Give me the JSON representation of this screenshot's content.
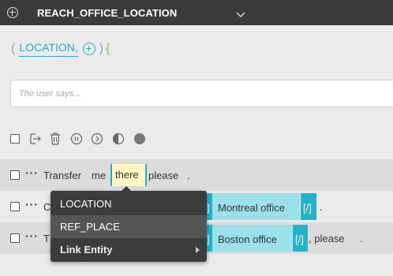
{
  "header": {
    "title": "REACH_OFFICE_LOCATION"
  },
  "params": {
    "open_paren": "(",
    "name": "LOCATION,",
    "close_paren": ")",
    "brace": "{"
  },
  "says": {
    "placeholder": "The user says..."
  },
  "toolbar_icons": [
    "checkbox",
    "move-icon",
    "trash-icon",
    "pause-icon",
    "forward-icon",
    "contrast-icon",
    "circle-icon"
  ],
  "rows": [
    {
      "w1": "Transfer",
      "w2": "me",
      "token": "there",
      "w3": "please",
      "end": "."
    },
    {
      "lead": "C",
      "entity": "Montreal  office",
      "close_tag": "[/]",
      "end": "."
    },
    {
      "lead": "T",
      "entity": "Boston  office",
      "close_tag": "[/]",
      "after": ",  please",
      "end": "."
    }
  ],
  "menu": {
    "items": [
      "LOCATION",
      "REF_PLACE",
      "Link Entity"
    ]
  },
  "colors": {
    "accent": "#2aa7c9",
    "highlight": "#fff8c2",
    "entity_bg": "#9be1ec",
    "tag_bg": "#22b3c9",
    "brace": "#8bc34a"
  }
}
